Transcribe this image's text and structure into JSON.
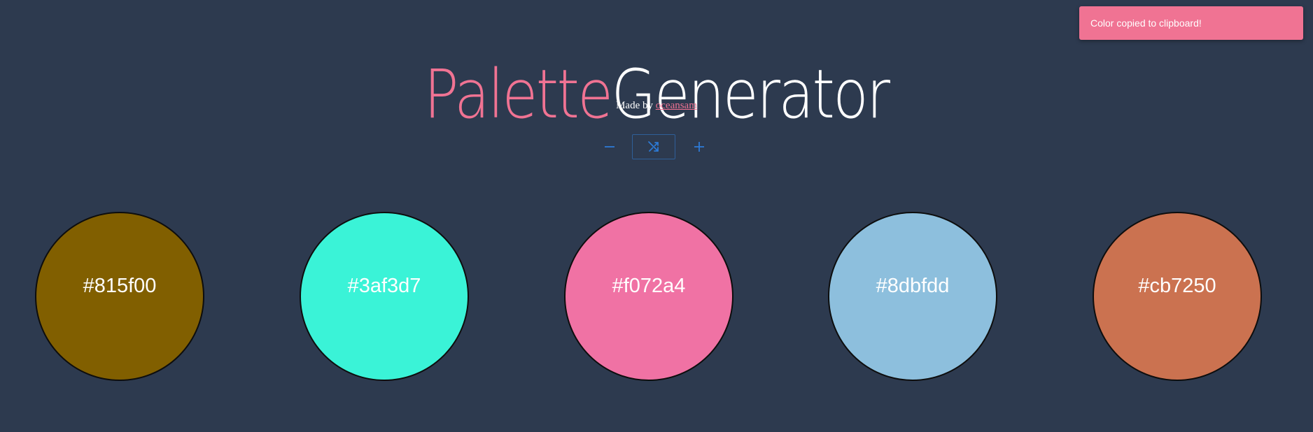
{
  "header": {
    "title_part_1": "Palette",
    "title_part_2": "Generator",
    "byline_prefix": "Made by",
    "author_link": "oceansam"
  },
  "controls": {
    "decrease_icon": "minus-icon",
    "shuffle_icon": "shuffle-icon",
    "increase_icon": "plus-icon",
    "accent_color": "#2d7ad6"
  },
  "palette": [
    {
      "hex": "#815f00"
    },
    {
      "hex": "#3af3d7"
    },
    {
      "hex": "#f072a4"
    },
    {
      "hex": "#8dbfdd"
    },
    {
      "hex": "#cb7250"
    }
  ],
  "toast": {
    "message": "Color copied to clipboard!",
    "color": "#f07393"
  },
  "colors": {
    "background": "#2d3a4f",
    "brand_pink": "#f07393"
  }
}
